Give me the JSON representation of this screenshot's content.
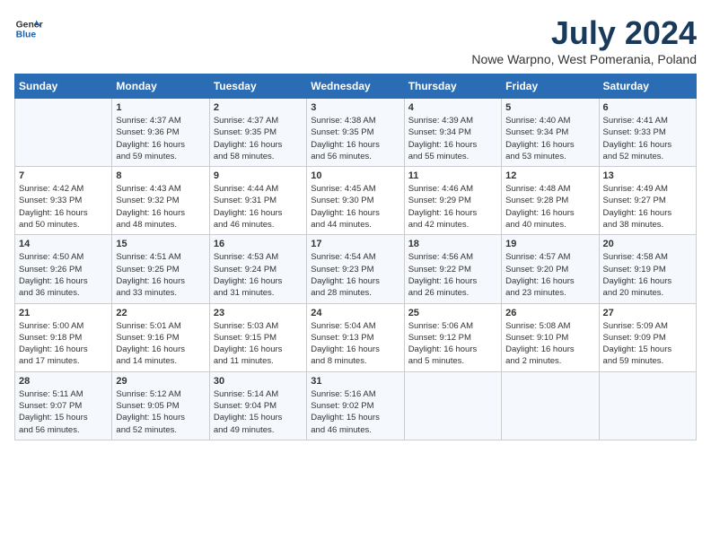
{
  "header": {
    "logo_general": "General",
    "logo_blue": "Blue",
    "month_title": "July 2024",
    "location": "Nowe Warpno, West Pomerania, Poland"
  },
  "days_of_week": [
    "Sunday",
    "Monday",
    "Tuesday",
    "Wednesday",
    "Thursday",
    "Friday",
    "Saturday"
  ],
  "weeks": [
    [
      {
        "day": "",
        "info": ""
      },
      {
        "day": "1",
        "info": "Sunrise: 4:37 AM\nSunset: 9:36 PM\nDaylight: 16 hours\nand 59 minutes."
      },
      {
        "day": "2",
        "info": "Sunrise: 4:37 AM\nSunset: 9:35 PM\nDaylight: 16 hours\nand 58 minutes."
      },
      {
        "day": "3",
        "info": "Sunrise: 4:38 AM\nSunset: 9:35 PM\nDaylight: 16 hours\nand 56 minutes."
      },
      {
        "day": "4",
        "info": "Sunrise: 4:39 AM\nSunset: 9:34 PM\nDaylight: 16 hours\nand 55 minutes."
      },
      {
        "day": "5",
        "info": "Sunrise: 4:40 AM\nSunset: 9:34 PM\nDaylight: 16 hours\nand 53 minutes."
      },
      {
        "day": "6",
        "info": "Sunrise: 4:41 AM\nSunset: 9:33 PM\nDaylight: 16 hours\nand 52 minutes."
      }
    ],
    [
      {
        "day": "7",
        "info": "Sunrise: 4:42 AM\nSunset: 9:33 PM\nDaylight: 16 hours\nand 50 minutes."
      },
      {
        "day": "8",
        "info": "Sunrise: 4:43 AM\nSunset: 9:32 PM\nDaylight: 16 hours\nand 48 minutes."
      },
      {
        "day": "9",
        "info": "Sunrise: 4:44 AM\nSunset: 9:31 PM\nDaylight: 16 hours\nand 46 minutes."
      },
      {
        "day": "10",
        "info": "Sunrise: 4:45 AM\nSunset: 9:30 PM\nDaylight: 16 hours\nand 44 minutes."
      },
      {
        "day": "11",
        "info": "Sunrise: 4:46 AM\nSunset: 9:29 PM\nDaylight: 16 hours\nand 42 minutes."
      },
      {
        "day": "12",
        "info": "Sunrise: 4:48 AM\nSunset: 9:28 PM\nDaylight: 16 hours\nand 40 minutes."
      },
      {
        "day": "13",
        "info": "Sunrise: 4:49 AM\nSunset: 9:27 PM\nDaylight: 16 hours\nand 38 minutes."
      }
    ],
    [
      {
        "day": "14",
        "info": "Sunrise: 4:50 AM\nSunset: 9:26 PM\nDaylight: 16 hours\nand 36 minutes."
      },
      {
        "day": "15",
        "info": "Sunrise: 4:51 AM\nSunset: 9:25 PM\nDaylight: 16 hours\nand 33 minutes."
      },
      {
        "day": "16",
        "info": "Sunrise: 4:53 AM\nSunset: 9:24 PM\nDaylight: 16 hours\nand 31 minutes."
      },
      {
        "day": "17",
        "info": "Sunrise: 4:54 AM\nSunset: 9:23 PM\nDaylight: 16 hours\nand 28 minutes."
      },
      {
        "day": "18",
        "info": "Sunrise: 4:56 AM\nSunset: 9:22 PM\nDaylight: 16 hours\nand 26 minutes."
      },
      {
        "day": "19",
        "info": "Sunrise: 4:57 AM\nSunset: 9:20 PM\nDaylight: 16 hours\nand 23 minutes."
      },
      {
        "day": "20",
        "info": "Sunrise: 4:58 AM\nSunset: 9:19 PM\nDaylight: 16 hours\nand 20 minutes."
      }
    ],
    [
      {
        "day": "21",
        "info": "Sunrise: 5:00 AM\nSunset: 9:18 PM\nDaylight: 16 hours\nand 17 minutes."
      },
      {
        "day": "22",
        "info": "Sunrise: 5:01 AM\nSunset: 9:16 PM\nDaylight: 16 hours\nand 14 minutes."
      },
      {
        "day": "23",
        "info": "Sunrise: 5:03 AM\nSunset: 9:15 PM\nDaylight: 16 hours\nand 11 minutes."
      },
      {
        "day": "24",
        "info": "Sunrise: 5:04 AM\nSunset: 9:13 PM\nDaylight: 16 hours\nand 8 minutes."
      },
      {
        "day": "25",
        "info": "Sunrise: 5:06 AM\nSunset: 9:12 PM\nDaylight: 16 hours\nand 5 minutes."
      },
      {
        "day": "26",
        "info": "Sunrise: 5:08 AM\nSunset: 9:10 PM\nDaylight: 16 hours\nand 2 minutes."
      },
      {
        "day": "27",
        "info": "Sunrise: 5:09 AM\nSunset: 9:09 PM\nDaylight: 15 hours\nand 59 minutes."
      }
    ],
    [
      {
        "day": "28",
        "info": "Sunrise: 5:11 AM\nSunset: 9:07 PM\nDaylight: 15 hours\nand 56 minutes."
      },
      {
        "day": "29",
        "info": "Sunrise: 5:12 AM\nSunset: 9:05 PM\nDaylight: 15 hours\nand 52 minutes."
      },
      {
        "day": "30",
        "info": "Sunrise: 5:14 AM\nSunset: 9:04 PM\nDaylight: 15 hours\nand 49 minutes."
      },
      {
        "day": "31",
        "info": "Sunrise: 5:16 AM\nSunset: 9:02 PM\nDaylight: 15 hours\nand 46 minutes."
      },
      {
        "day": "",
        "info": ""
      },
      {
        "day": "",
        "info": ""
      },
      {
        "day": "",
        "info": ""
      }
    ]
  ]
}
